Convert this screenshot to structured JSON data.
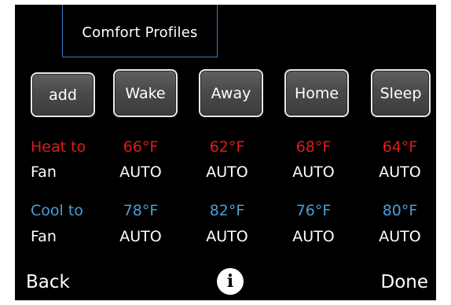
{
  "header": {
    "title": "Comfort Profiles"
  },
  "buttons": {
    "add": "add",
    "profiles": [
      "Wake",
      "Away",
      "Home",
      "Sleep"
    ]
  },
  "rows": {
    "heat": {
      "label": "Heat to",
      "values": [
        "66°F",
        "62°F",
        "68°F",
        "64°F"
      ]
    },
    "heat_fan": {
      "label": "Fan",
      "values": [
        "AUTO",
        "AUTO",
        "AUTO",
        "AUTO"
      ]
    },
    "cool": {
      "label": "Cool to",
      "values": [
        "78°F",
        "82°F",
        "76°F",
        "80°F"
      ]
    },
    "cool_fan": {
      "label": "Fan",
      "values": [
        "AUTO",
        "AUTO",
        "AUTO",
        "AUTO"
      ]
    }
  },
  "footer": {
    "back": "Back",
    "info": "i",
    "done": "Done"
  },
  "colors": {
    "screen_bg": "#000000",
    "heat": "#e01b1b",
    "cool": "#4a9ed6",
    "text": "#ffffff",
    "title_border": "#3a78c6"
  }
}
